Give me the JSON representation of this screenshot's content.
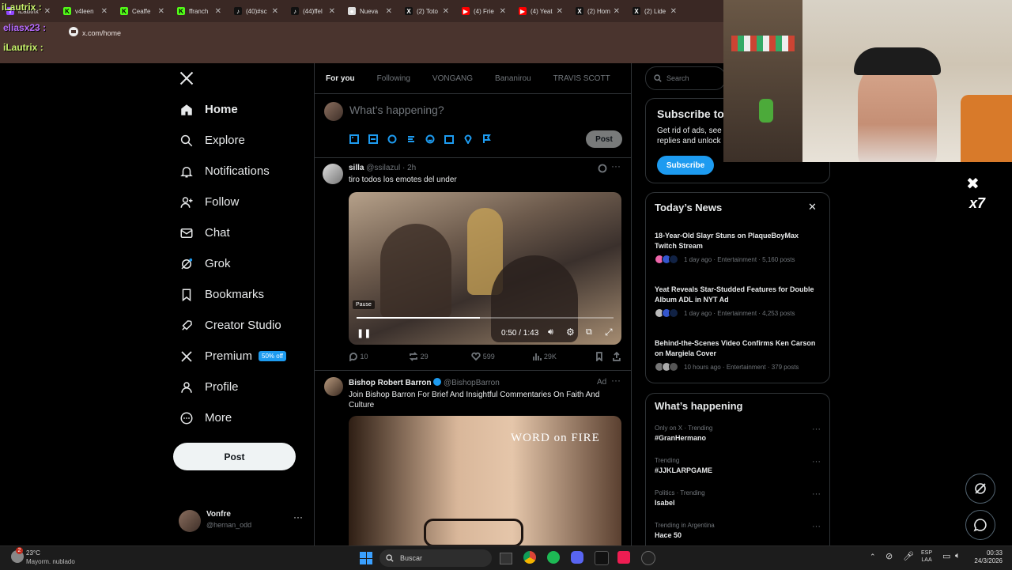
{
  "browser": {
    "tabs": [
      {
        "label": "iLautrix",
        "icon": "twitch-icon"
      },
      {
        "label": "v4leen",
        "icon": "kick-icon"
      },
      {
        "label": "Ceaffe",
        "icon": "kick-icon"
      },
      {
        "label": "ffranch",
        "icon": "kick-icon"
      },
      {
        "label": "(40)#sc",
        "icon": "tiktok-icon"
      },
      {
        "label": "(44)ffel",
        "icon": "tiktok-icon"
      },
      {
        "label": "Nueva",
        "icon": "chrome-icon"
      },
      {
        "label": "(2) Toto",
        "icon": "x-icon"
      },
      {
        "label": "(4) Frie",
        "icon": "youtube-icon"
      },
      {
        "label": "(4) Yeat",
        "icon": "youtube-icon"
      },
      {
        "label": "(2) Hom",
        "icon": "x-icon"
      },
      {
        "label": "(2) Lide",
        "icon": "x-icon"
      }
    ],
    "url": "x.com/home",
    "chat": [
      {
        "user": "iLautrix",
        "sep": ":"
      },
      {
        "user": "eliasx23",
        "sep": ":"
      },
      {
        "user": "iLautrix",
        "sep": ":"
      }
    ]
  },
  "nav": {
    "items": [
      {
        "label": "Home",
        "icon": "home-icon"
      },
      {
        "label": "Explore",
        "icon": "search-icon"
      },
      {
        "label": "Notifications",
        "icon": "bell-icon"
      },
      {
        "label": "Follow",
        "icon": "person-plus-icon"
      },
      {
        "label": "Chat",
        "icon": "mail-icon"
      },
      {
        "label": "Grok",
        "icon": "grok-icon"
      },
      {
        "label": "Bookmarks",
        "icon": "bookmark-icon"
      },
      {
        "label": "Creator Studio",
        "icon": "rocket-icon"
      },
      {
        "label": "Premium",
        "icon": "x-icon",
        "badge": "50% off"
      },
      {
        "label": "Profile",
        "icon": "person-icon"
      },
      {
        "label": "More",
        "icon": "more-circle-icon"
      }
    ],
    "post_label": "Post",
    "account": {
      "name": "Vonfre",
      "handle": "@hernan_odd"
    }
  },
  "feed": {
    "tabs": [
      "For you",
      "Following",
      "VONGANG",
      "Bananirou",
      "TRAVIS SCOTT"
    ],
    "compose_placeholder": "What’s happening?",
    "compose_post": "Post",
    "tweet1": {
      "name": "silla",
      "handle": "@ssilazul",
      "time": "· 2h",
      "text": "tiro todos los emotes del under",
      "video_time": "0:50 / 1:43",
      "video_progress": 0.48,
      "pause_tooltip": "Pause",
      "replies": "10",
      "reposts": "29",
      "likes": "599",
      "views": "29K"
    },
    "tweet2": {
      "name": "Bishop Robert Barron",
      "handle": "@BishopBarron",
      "ad": "Ad",
      "text": "Join Bishop Barron For Brief And Insightful Commentaries On Faith And Culture",
      "brand": "WORD on FIRE"
    }
  },
  "right": {
    "search_placeholder": "Search",
    "subscribe": {
      "title": "Subscribe to",
      "body": "Get rid of ads, see replies and unlock",
      "button": "Subscribe"
    },
    "news": {
      "title": "Today’s News",
      "items": [
        {
          "headline": "18-Year-Old Slayr Stuns on PlaqueBoyMax Twitch Stream",
          "meta": "1 day ago · Entertainment · 5,160 posts"
        },
        {
          "headline": "Yeat Reveals Star-Studded Features for Double Album ADL in NYT Ad",
          "meta": "1 day ago · Entertainment · 4,253 posts"
        },
        {
          "headline": "Behind-the-Scenes Video Confirms Ken Carson on Margiela Cover",
          "meta": "10 hours ago · Entertainment · 379 posts"
        }
      ]
    },
    "happening": {
      "title": "What’s happening",
      "items": [
        {
          "context": "Only on X · Trending",
          "name": "#GranHermano"
        },
        {
          "context": "Trending",
          "name": "#JJKLARPGAME"
        },
        {
          "context": "Politics · Trending",
          "name": "Isabel"
        },
        {
          "context": "Trending in Argentina",
          "name": "Hace 50"
        }
      ]
    }
  },
  "overlay": {
    "volume_label": "x7"
  },
  "taskbar": {
    "weather_temp": "23°C",
    "weather_desc": "Mayorm. nublado",
    "weather_badge": "2",
    "search": "Buscar",
    "lang1": "ESP",
    "lang2": "LAA",
    "time": "00:33",
    "date": "24/3/2026"
  },
  "colors": {
    "accent": "#1d9bf0",
    "background": "#000000",
    "text": "#e7e9ea",
    "muted": "#71767b",
    "border": "#2f3336"
  }
}
